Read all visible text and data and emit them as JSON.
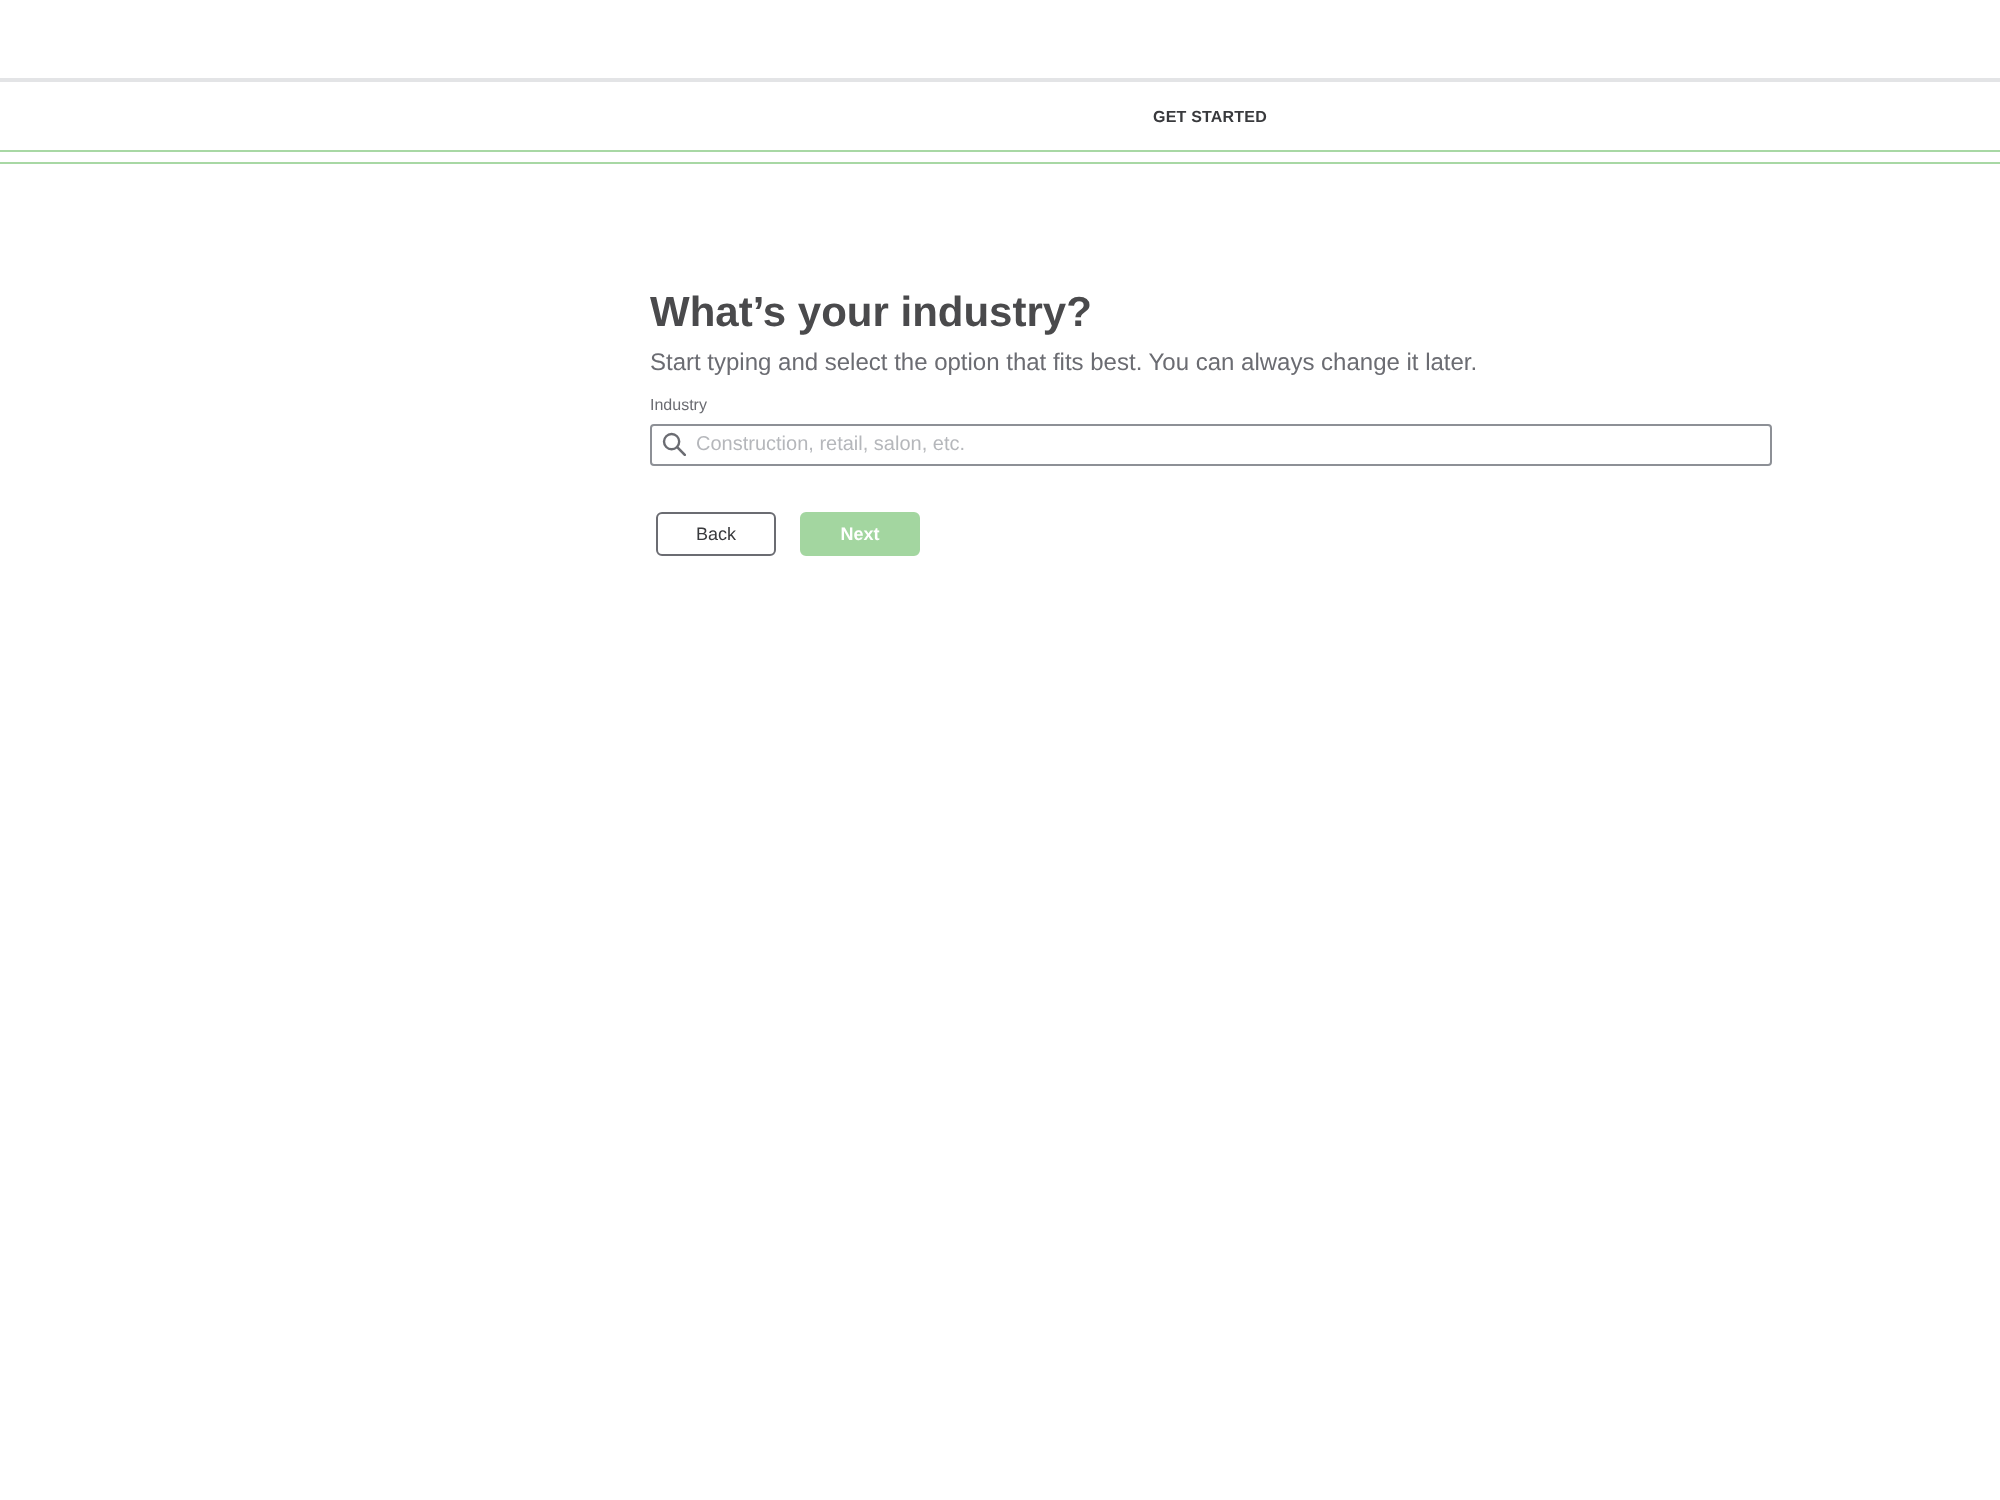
{
  "header": {
    "title": "GET STARTED"
  },
  "page": {
    "heading": "What’s your industry?",
    "subtitle": "Start typing and select the option that fits best. You can always change it later."
  },
  "industry_field": {
    "label": "Industry",
    "placeholder": "Construction, retail, salon, etc."
  },
  "buttons": [
    {
      "label": "Back",
      "kind": "secondary",
      "disabled": false
    },
    {
      "label": "Next",
      "kind": "primary",
      "disabled": true
    }
  ]
}
